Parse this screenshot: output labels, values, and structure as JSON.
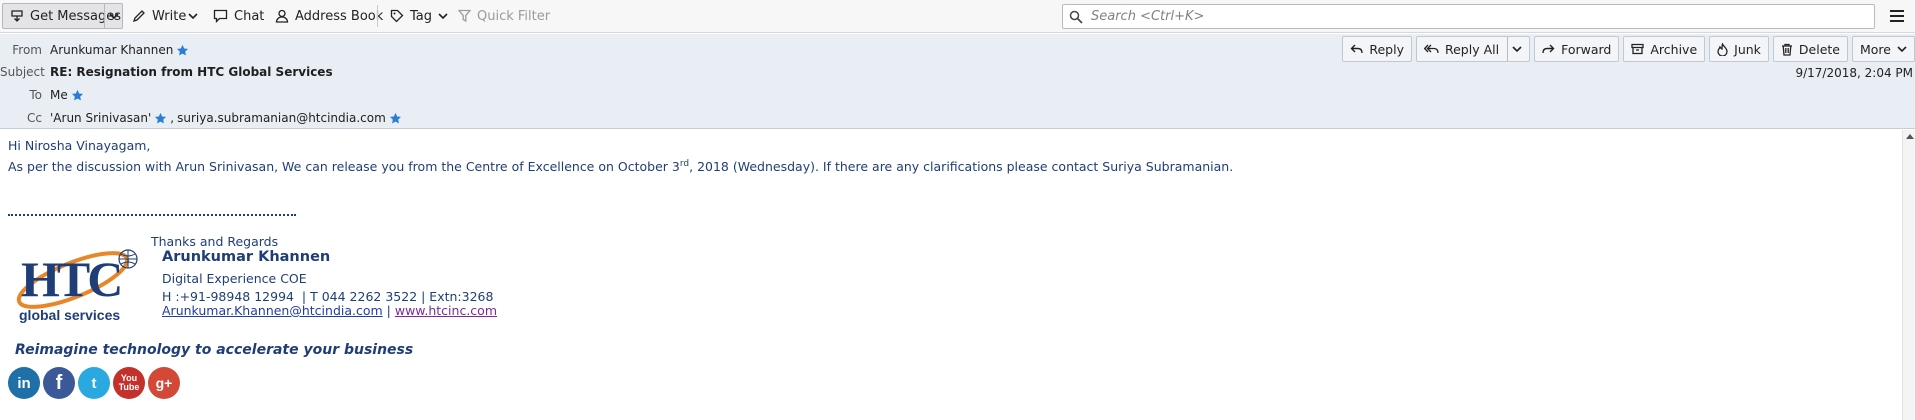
{
  "toolbar": {
    "get_messages": "Get Messages",
    "write": "Write",
    "chat": "Chat",
    "address_book": "Address Book",
    "tag": "Tag",
    "quick_filter": "Quick Filter",
    "search_placeholder": "Search <Ctrl+K>"
  },
  "header": {
    "from_label": "From",
    "from_value": "Arunkumar Khannen",
    "subject_label": "Subject",
    "subject_value": "RE: Resignation from HTC Global Services",
    "to_label": "To",
    "to_value": "Me",
    "cc_label": "Cc",
    "cc_value_1": "'Arun Srinivasan'",
    "cc_value_2": "suriya.subramanian@htcindia.com",
    "date": "9/17/2018, 2:04 PM",
    "actions": {
      "reply": "Reply",
      "reply_all": "Reply All",
      "forward": "Forward",
      "archive": "Archive",
      "junk": "Junk",
      "delete": "Delete",
      "more": "More"
    }
  },
  "body": {
    "greeting": "Hi Nirosha Vinayagam,",
    "para_part1": "As per the discussion with Arun Srinivasan, We can release you from the Centre of Excellence on October 3",
    "para_sup": "rd",
    "para_part2": ", 2018 (Wednesday). If there are any clarifications please contact Suriya Subramanian.",
    "signature": {
      "thanks": "Thanks and Regards",
      "name": "Arunkumar Khannen",
      "dept": "Digital Experience COE",
      "phone": "H :+91-98948 12994  | T 044 2262 3522 | Extn:3268",
      "email": "Arunkumar.Khannen@htcindia.com",
      "separator": " | ",
      "website": "www.htcinc.com",
      "tagline": "Reimagine technology to accelerate your business",
      "logo_text_top": "HTC",
      "logo_text_bottom": "global services",
      "social": [
        "in",
        "f",
        "t",
        "You Tube",
        "g+"
      ]
    }
  },
  "colors": {
    "header_bg": "#e9eef4",
    "body_text": "#1f3e78",
    "star": "#2a7fd4"
  }
}
